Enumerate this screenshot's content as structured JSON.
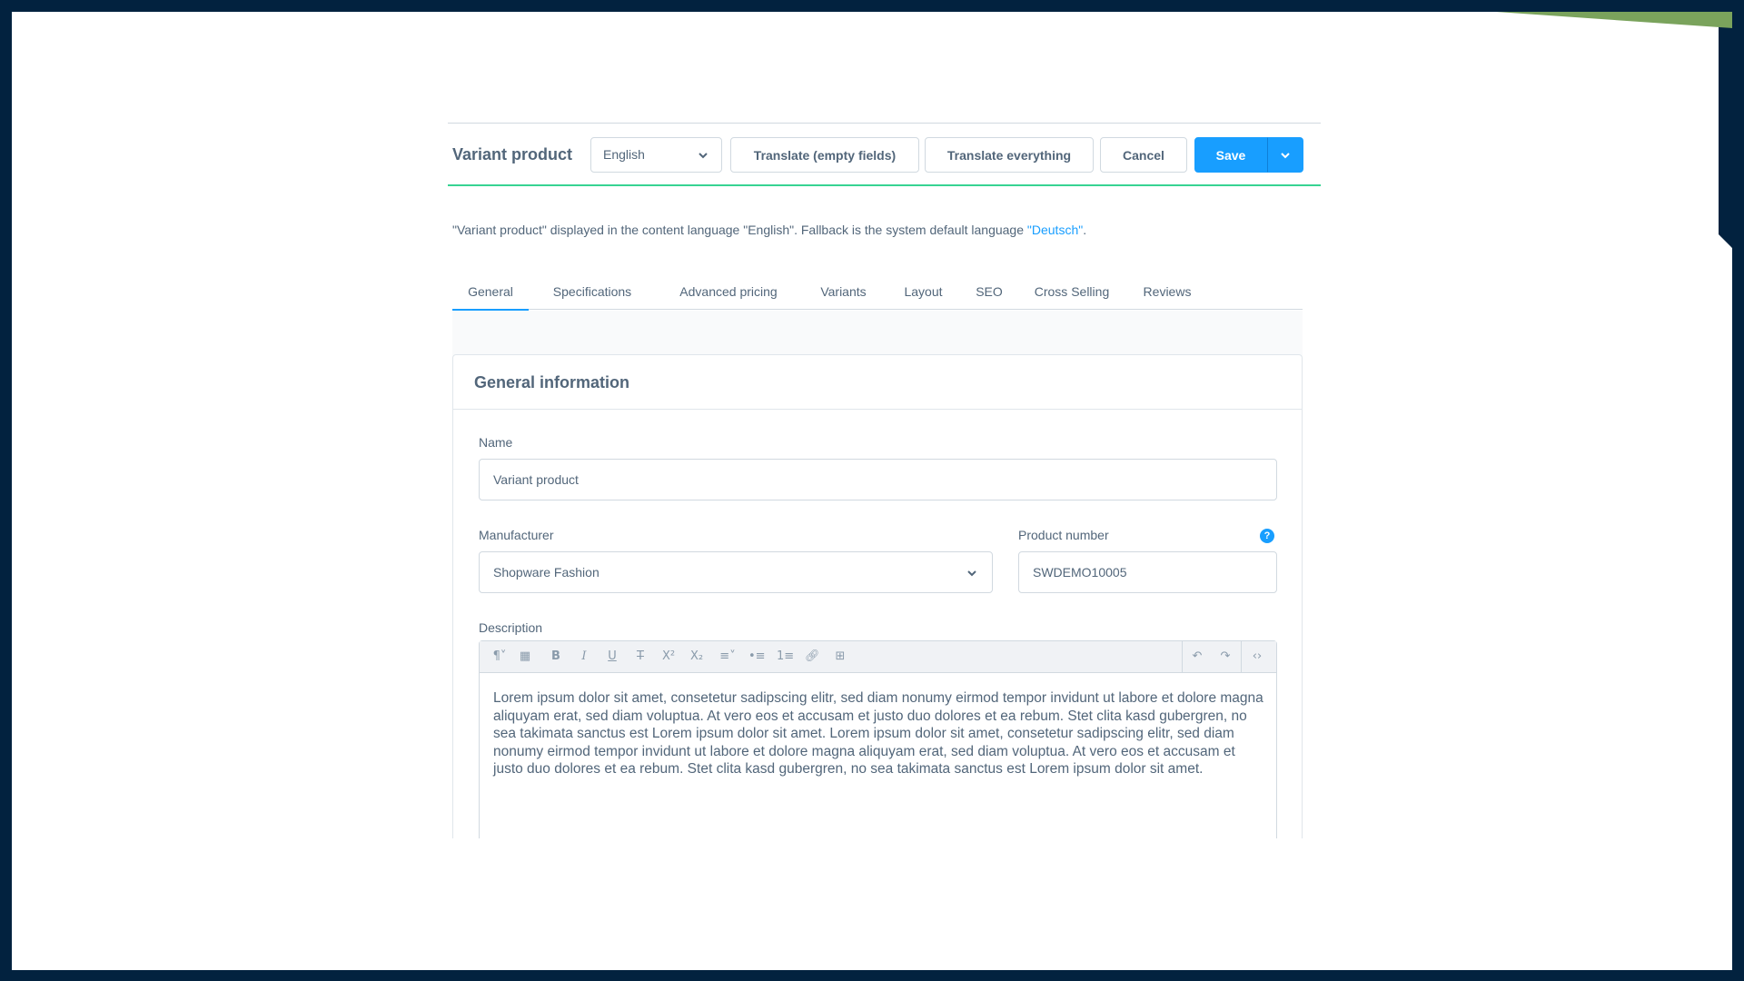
{
  "header": {
    "title": "Variant product",
    "language": "English",
    "translate_empty_label": "Translate (empty fields)",
    "translate_all_label": "Translate everything",
    "cancel_label": "Cancel",
    "save_label": "Save"
  },
  "info": {
    "prefix": "\"Variant product\" displayed in the content language \"English\". Fallback is the system default language ",
    "link": "\"Deutsch\"",
    "suffix": "."
  },
  "tabs": [
    {
      "label": "General",
      "active": true
    },
    {
      "label": "Specifications"
    },
    {
      "label": "Advanced pricing"
    },
    {
      "label": "Variants"
    },
    {
      "label": "Layout"
    },
    {
      "label": "SEO"
    },
    {
      "label": "Cross Selling"
    },
    {
      "label": "Reviews"
    }
  ],
  "card": {
    "title": "General information",
    "name_label": "Name",
    "name_value": "Variant product",
    "manufacturer_label": "Manufacturer",
    "manufacturer_value": "Shopware Fashion",
    "product_number_label": "Product number",
    "product_number_value": "SWDEMO10005",
    "description_label": "Description",
    "description_text": "Lorem ipsum dolor sit amet, consetetur sadipscing elitr, sed diam nonumy eirmod tempor invidunt ut labore et dolore magna aliquyam erat, sed diam voluptua. At vero eos et accusam et justo duo dolores et ea rebum. Stet clita kasd gubergren, no sea takimata sanctus est Lorem ipsum dolor sit amet. Lorem ipsum dolor sit amet, consetetur sadipscing elitr, sed diam nonumy eirmod tempor invidunt ut labore et dolore magna aliquyam erat, sed diam voluptua. At vero eos et accusam et justo duo dolores et ea rebum. Stet clita kasd gubergren, no sea takimata sanctus est Lorem ipsum dolor sit amet."
  },
  "colors": {
    "primary": "#189eff",
    "accent_line": "#37d392",
    "frame": "#02223f",
    "corner": "#7aa35c"
  },
  "icons": {
    "help": "?"
  }
}
